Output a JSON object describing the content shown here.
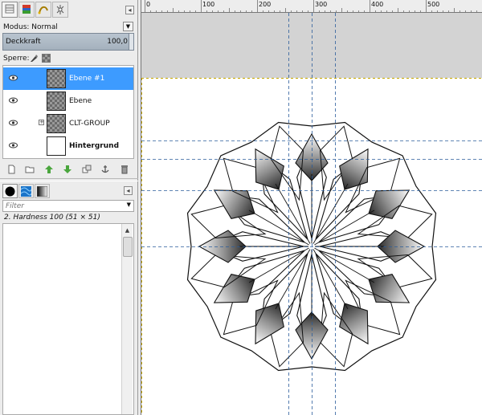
{
  "dock_tabs": [
    "layers-tab-icon",
    "channels-tab-icon",
    "paths-tab-icon",
    "undo-history-tab-icon"
  ],
  "layers_panel": {
    "mode_label": "Modus: Normal",
    "opacity_label": "Deckkraft",
    "opacity_value": "100,0",
    "lock_label": "Sperre:",
    "layers": [
      {
        "name": "Ebene #1",
        "bold": false,
        "selected": true,
        "visible": true,
        "group": false,
        "thumb": "checker"
      },
      {
        "name": "Ebene",
        "bold": false,
        "selected": false,
        "visible": true,
        "group": false,
        "thumb": "checker"
      },
      {
        "name": "CLT-GROUP",
        "bold": false,
        "selected": false,
        "visible": true,
        "group": true,
        "thumb": "checker"
      },
      {
        "name": "Hintergrund",
        "bold": true,
        "selected": false,
        "visible": true,
        "group": false,
        "thumb": "white"
      }
    ],
    "actions": [
      "new-layer-icon",
      "new-layer-group-icon",
      "raise-layer-icon",
      "lower-layer-icon",
      "duplicate-layer-icon",
      "anchor-layer-icon",
      "delete-layer-icon"
    ]
  },
  "brushes_panel": {
    "tabs": [
      "brushes-tab-icon",
      "patterns-tab-icon",
      "gradients-tab-icon"
    ],
    "filter_placeholder": "Filter",
    "brush_name": "2. Hardness 100 (51 × 51)"
  },
  "ruler": {
    "labels": [
      "0",
      "100",
      "200",
      "300",
      "400",
      "500"
    ]
  },
  "colors": {
    "selection": "#3d9bff",
    "guides": "#2b5d9c",
    "canvas": "#ffffff",
    "workspace": "#d3d3d3"
  }
}
